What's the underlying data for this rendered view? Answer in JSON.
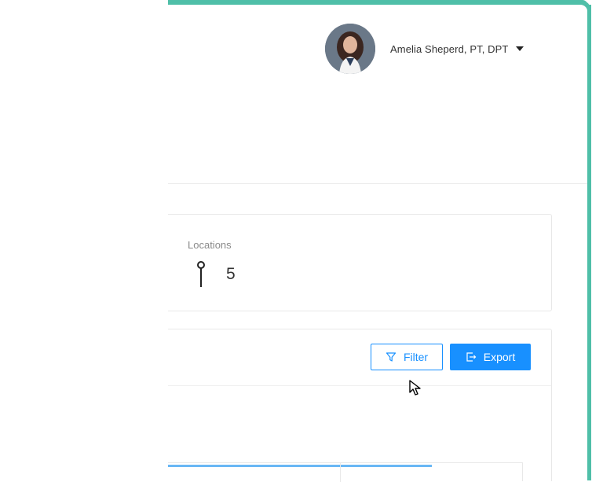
{
  "header": {
    "user": {
      "name": "Amelia Sheperd, PT, DPT",
      "avatar_icon": "user-avatar-photo",
      "menu_icon": "caret-down-icon"
    }
  },
  "stats": {
    "locations": {
      "label": "Locations",
      "value": "5",
      "icon": "location-pin-icon"
    }
  },
  "table_toolbar": {
    "filter_label": "Filter",
    "filter_icon": "filter-funnel-icon",
    "export_label": "Export",
    "export_icon": "export-icon"
  },
  "colors": {
    "accent": "#4fbfa8",
    "primary": "#1890ff"
  }
}
